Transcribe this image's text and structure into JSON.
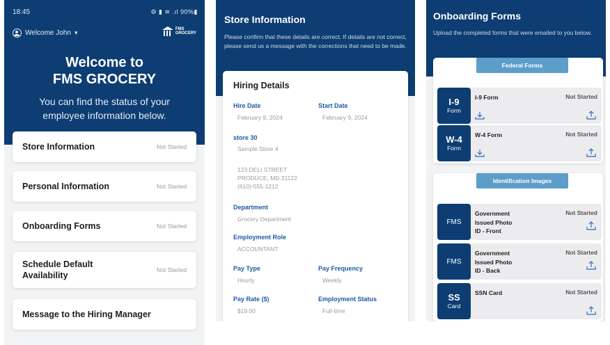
{
  "colors": {
    "navy": "#0d3d73",
    "accent_blue": "#1e5aa6",
    "pill_blue": "#5c9ec9"
  },
  "welcome_screen": {
    "status_bar": {
      "time": "18:45",
      "system_icons": "⚙ ▮ ≋ .ıl 90%▮"
    },
    "user_menu": {
      "label": "Welcome John",
      "icon": "user-circle-icon"
    },
    "logo": {
      "line1": "FMS",
      "line2": "GROCERY"
    },
    "title_line1": "Welcome to",
    "title_line2": "FMS GROCERY",
    "subtitle_line1": "You can find the status of your",
    "subtitle_line2": "employee information below.",
    "menu": [
      {
        "label": "Store Information",
        "status": "Not Started"
      },
      {
        "label": "Personal Information",
        "status": "Not Started"
      },
      {
        "label": "Onboarding Forms",
        "status": "Not Started"
      },
      {
        "label_line1": "Schedule Default",
        "label_line2": "Availability",
        "status": "Not Started"
      },
      {
        "label": "Message to the Hiring Manager"
      }
    ]
  },
  "store_info": {
    "title": "Store Information",
    "description": "Please confirm that these details are correct. If details are not correct, please send us a message with the corrections that need to be made.",
    "card_title": "Hiring Details",
    "hire_date_label": "Hire Date",
    "hire_date": "February 9, 2024",
    "start_date_label": "Start Date",
    "start_date": "February 9, 2024",
    "store_label": "store 30",
    "store_name": "Sample Store 4",
    "address_line1": "123 DELI STREET",
    "address_line2": "PRODUCE, MD 21122",
    "address_line3": "(610)-555-1212",
    "department_label": "Department",
    "department": "Grocery Department",
    "role_label": "Employment Role",
    "role": "ACCOUNTANT",
    "pay_type_label": "Pay Type",
    "pay_type": "Hourly",
    "pay_freq_label": "Pay Frequency",
    "pay_freq": "Weekly",
    "pay_rate_label": "Pay Rate ($)",
    "pay_rate": "$19.00",
    "emp_status_label": "Employment Status",
    "emp_status": "Full-time"
  },
  "onboarding": {
    "title": "Onboarding Forms",
    "description": "Upload the completed forms that were emailed to you below.",
    "federal_label": "Federal Forms",
    "id_label": "Identification Images",
    "forms": [
      {
        "code": "I-9",
        "sub": "Form",
        "name": "I-9 Form",
        "status": "Not Started"
      },
      {
        "code": "W-4",
        "sub": "Form",
        "name": "W-4 Form",
        "status": "Not Started"
      }
    ],
    "images": [
      {
        "code": "FMS",
        "name_line1": "Government",
        "name_line2": "Issued Photo",
        "name_line3": "ID - Front",
        "status": "Not Started"
      },
      {
        "code": "FMS",
        "name_line1": "Government",
        "name_line2": "Issued Photo",
        "name_line3": "ID - Back",
        "status": "Not Started"
      },
      {
        "code": "SS",
        "sub": "Card",
        "name_line1": "SSN Card",
        "status": "Not Started"
      }
    ]
  }
}
